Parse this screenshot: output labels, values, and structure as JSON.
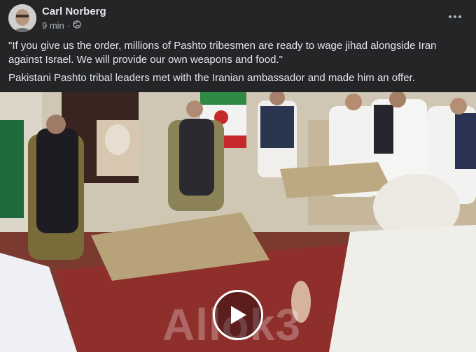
{
  "post": {
    "author": "Carl Norberg",
    "timestamp": "9 min",
    "audience_icon": "globe-icon",
    "more_icon": "more-horizontal-icon",
    "caption_quote": "\"If you give us the order, millions of Pashto tribesmen are ready to wage jihad alongside Iran against Israel. We will provide our own weapons and food.\"",
    "caption_body": "Pakistani Pashto tribal leaders met with the Iranian ambassador and made him an offer."
  },
  "video": {
    "watermark": "Allok3",
    "play_icon": "play-icon"
  },
  "colors": {
    "background": "#242526",
    "text_primary": "#e4e6eb",
    "text_secondary": "#b0b3b8"
  }
}
